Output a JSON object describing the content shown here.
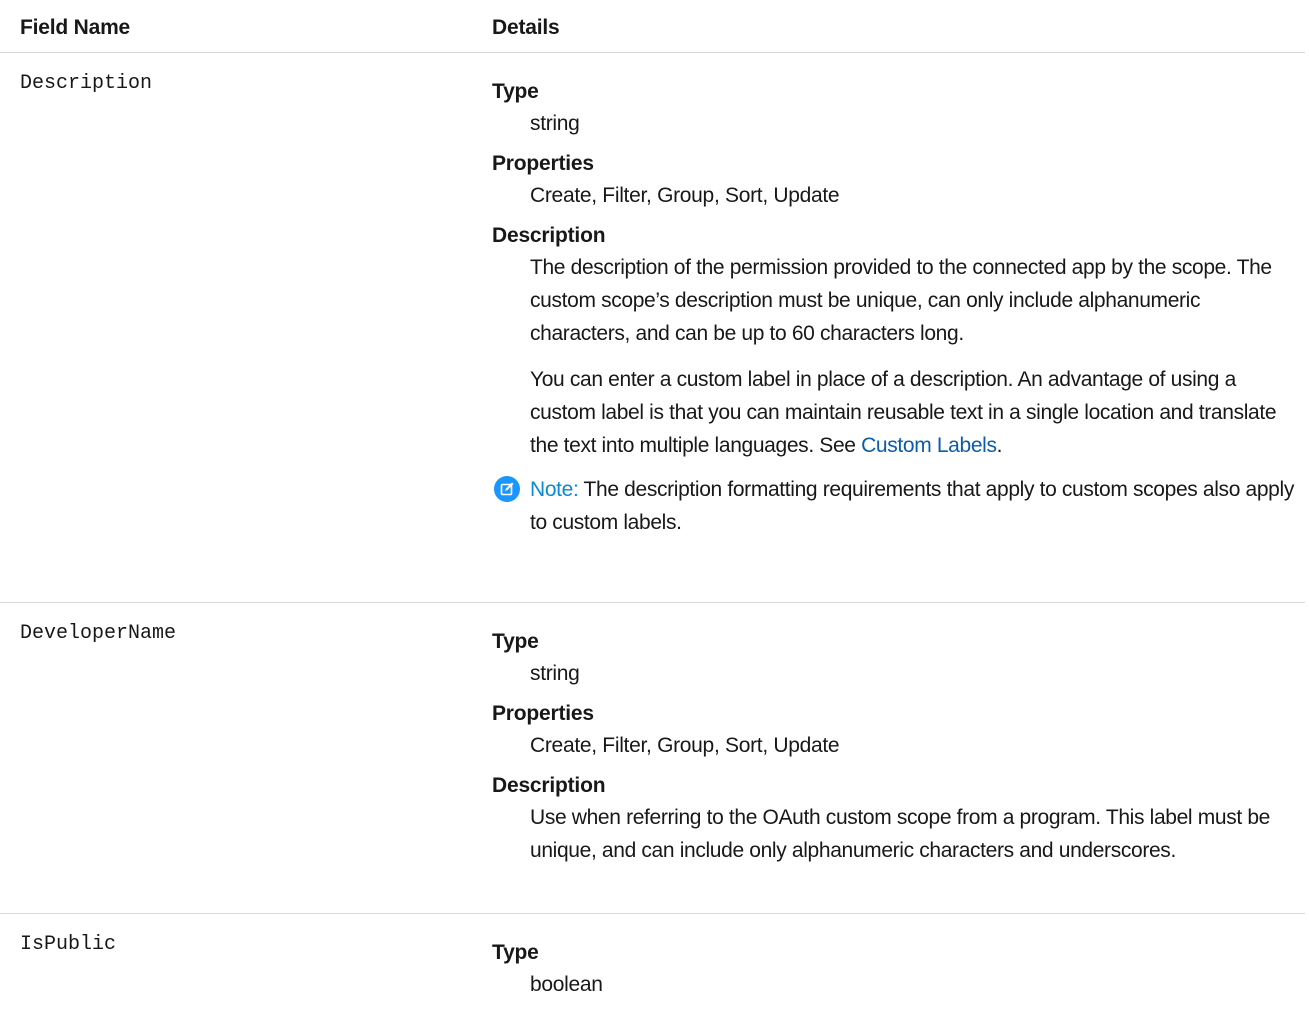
{
  "header": {
    "field_name": "Field Name",
    "details": "Details"
  },
  "rows": [
    {
      "field": "Description",
      "type_label": "Type",
      "type_value": "string",
      "properties_label": "Properties",
      "properties_value": "Create, Filter, Group, Sort, Update",
      "description_label": "Description",
      "description_p1": "The description of the permission provided to the connected app by the scope. The custom scope’s description must be unique, can only include alphanumeric characters, and can be up to 60 characters long.",
      "description_p2_before_link": "You can enter a custom label in place of a description. An advantage of using a custom label is that you can maintain reusable text in a single location and translate the text into multiple languages. See ",
      "description_p2_link": "Custom Labels",
      "description_p2_after_link": ".",
      "note_label": "Note:",
      "note_text": " The description formatting requirements that apply to custom scopes also apply to custom labels.",
      "note_icon": "edit-note-icon"
    },
    {
      "field": "DeveloperName",
      "type_label": "Type",
      "type_value": "string",
      "properties_label": "Properties",
      "properties_value": "Create, Filter, Group, Sort, Update",
      "description_label": "Description",
      "description_p1": "Use when referring to the OAuth custom scope from a program. This label must be unique, and can include only alphanumeric characters and underscores."
    },
    {
      "field": "IsPublic",
      "type_label": "Type",
      "type_value": "boolean"
    }
  ],
  "colors": {
    "link": "#0b5cab",
    "note_icon_bg": "#1b96ff",
    "divider": "#d8d8d8"
  }
}
